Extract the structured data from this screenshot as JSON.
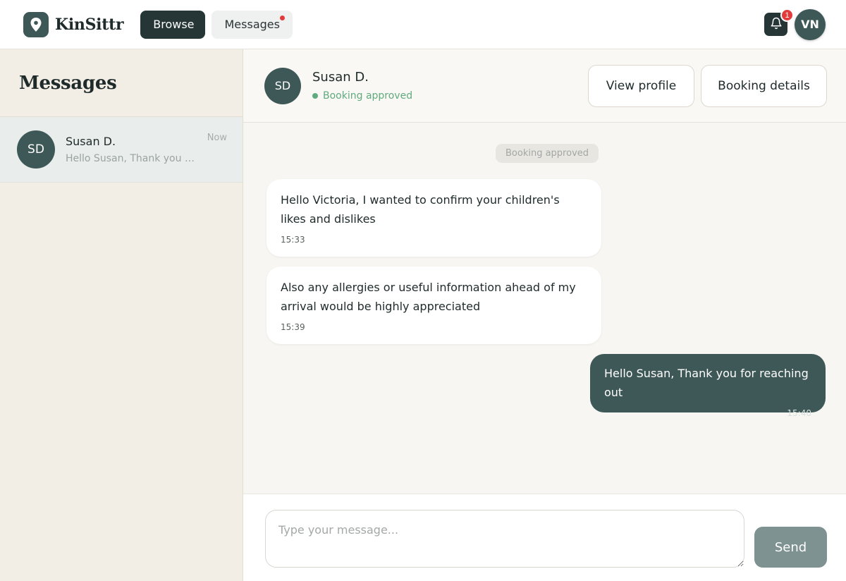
{
  "app": {
    "name": "KinSittr",
    "logo_icon": "map-pin-icon"
  },
  "nav": {
    "browse_label": "Browse",
    "messages_label": "Messages",
    "messages_has_unread": true
  },
  "header": {
    "notifications_count": "1",
    "user_initials": "VN"
  },
  "sidebar": {
    "title": "Messages",
    "conversations": [
      {
        "initials": "SD",
        "name": "Susan D.",
        "preview": "Hello Susan, Thank you for reaching out",
        "time": "Now",
        "selected": true
      }
    ]
  },
  "chat": {
    "contact": {
      "initials": "SD",
      "name": "Susan D.",
      "status": "Booking approved"
    },
    "actions": {
      "view_profile": "View profile",
      "booking_details": "Booking details"
    },
    "system_notice": "Booking approved",
    "messages": [
      {
        "direction": "incoming",
        "text": "Hello Victoria, I wanted to confirm your children's likes and dislikes",
        "time": "15:33"
      },
      {
        "direction": "incoming",
        "text": "Also any allergies or useful information ahead of my arrival would be highly appreciated",
        "time": "15:39"
      },
      {
        "direction": "outgoing",
        "text": "Hello Susan, Thank you for reaching out",
        "time": "15:40"
      }
    ],
    "composer": {
      "placeholder": "Type your message...",
      "value": "",
      "send_label": "Send"
    }
  },
  "colors": {
    "brand_dark": "#263636",
    "brand": "#3e5757",
    "status_green": "#5faa7e",
    "badge_red": "#e23b3b",
    "sidebar_bg": "#f2ede5",
    "send_button": "#7d9291"
  }
}
